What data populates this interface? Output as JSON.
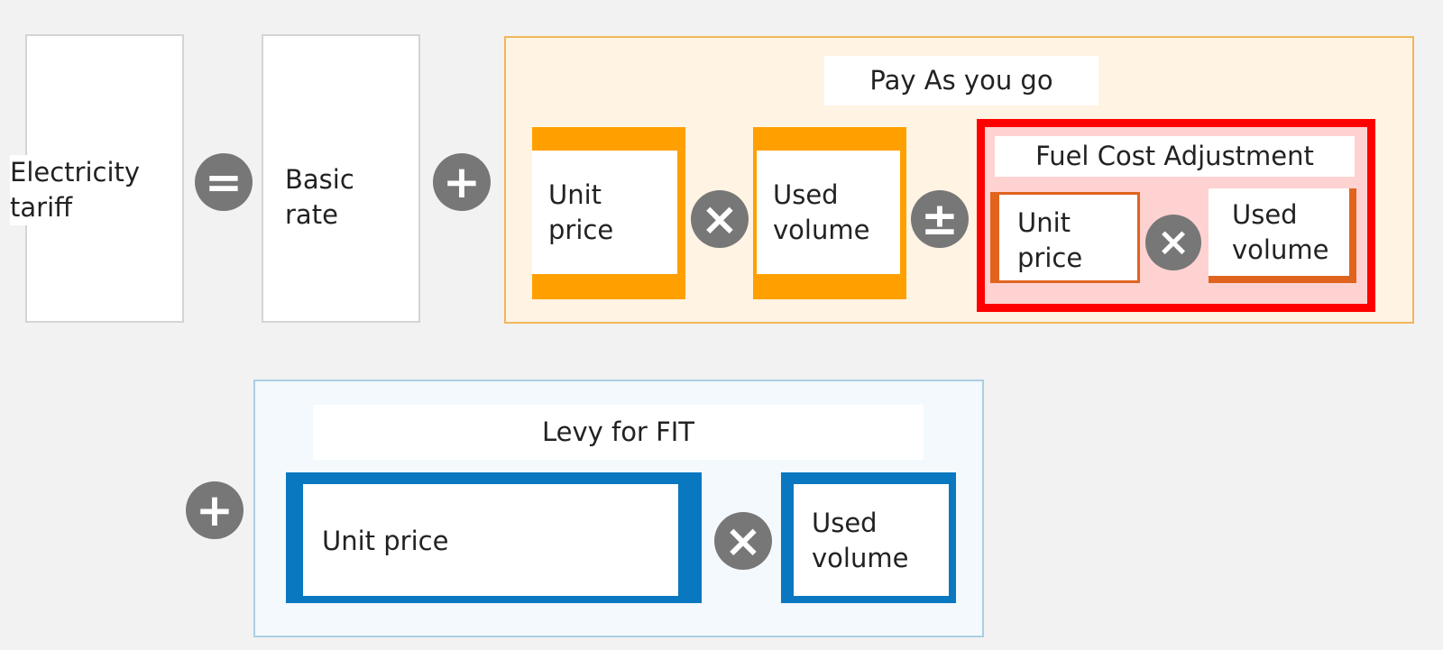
{
  "equation": {
    "tariff_label": "Electricity\ntariff",
    "basic_rate_label": "Basic\nrate",
    "operators": {
      "equals": "=",
      "plus": "+",
      "times": "×",
      "plus_minus": "±"
    }
  },
  "pay_as_you_go": {
    "title": "Pay As you go",
    "unit_price_label": "Unit\nprice",
    "used_volume_label": "Used\nvolume",
    "fuel_cost_adjustment": {
      "title": "Fuel Cost Adjustment",
      "unit_price_label": "Unit\nprice",
      "used_volume_label": "Used\nvolume"
    }
  },
  "levy": {
    "title": "Levy for FIT",
    "unit_price_label": "Unit price",
    "used_volume_label": "Used\nvolume"
  },
  "colors": {
    "orange": "#ffa000",
    "orange_dark": "#e0641e",
    "red": "#ff0000",
    "blue": "#0a78c0",
    "gray_operator": "#777777"
  }
}
